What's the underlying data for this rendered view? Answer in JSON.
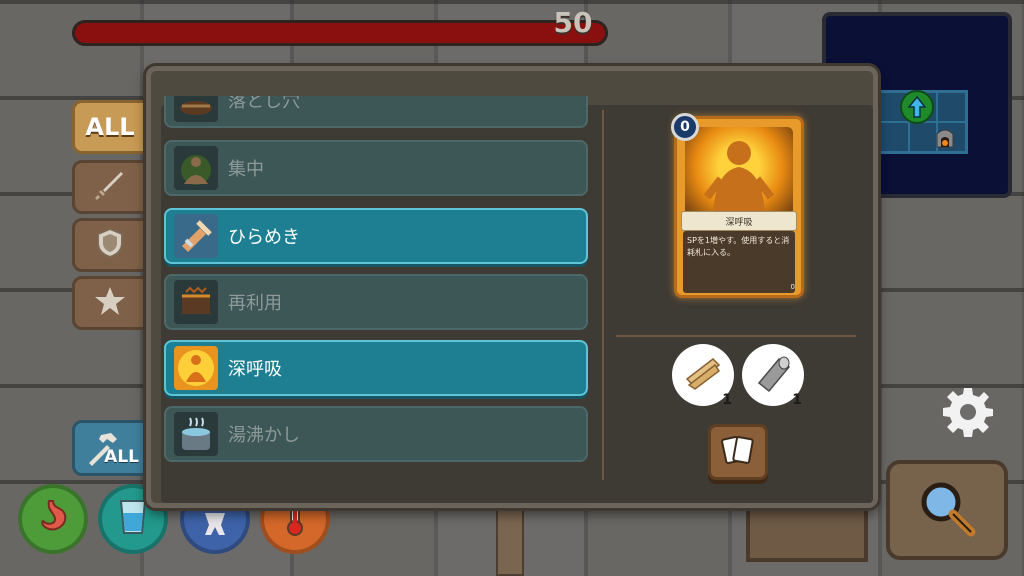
{
  "hud": {
    "health_value": "50",
    "health_fill_fraction": 1.0
  },
  "minimap": {
    "player_marker_icon": "arrow-up-icon",
    "furnace_icon": "furnace-icon"
  },
  "category_tabs": [
    {
      "label": "ALL",
      "icon": "all-text",
      "active": true
    },
    {
      "label": "",
      "icon": "sword-icon",
      "active": false
    },
    {
      "label": "",
      "icon": "shield-icon",
      "active": false
    },
    {
      "label": "",
      "icon": "star-icon",
      "active": false
    }
  ],
  "craft_all_button": {
    "label": "ALL",
    "icon": "hammer-icon"
  },
  "status_icons": [
    "stomach-icon",
    "water-glass-icon",
    "body-icon",
    "thermometer-icon"
  ],
  "recipe_list": [
    {
      "name": "落とし穴",
      "active": false
    },
    {
      "name": "集中",
      "active": false
    },
    {
      "name": "ひらめき",
      "active": true
    },
    {
      "name": "再利用",
      "active": false
    },
    {
      "name": "深呼吸",
      "active": true
    },
    {
      "name": "湯沸かし",
      "active": false
    }
  ],
  "selected_card": {
    "cost": "0",
    "name": "深呼吸",
    "description": "SPを1増やす。使用すると消耗札に入る。",
    "corner_value": "0"
  },
  "materials": [
    {
      "icon": "wood-plank-icon",
      "count": "1"
    },
    {
      "icon": "paper-roll-icon",
      "count": "1"
    }
  ],
  "craft_button_icon": "cards-icon",
  "settings_icon": "gear-icon",
  "search_icon": "magnifier-icon"
}
